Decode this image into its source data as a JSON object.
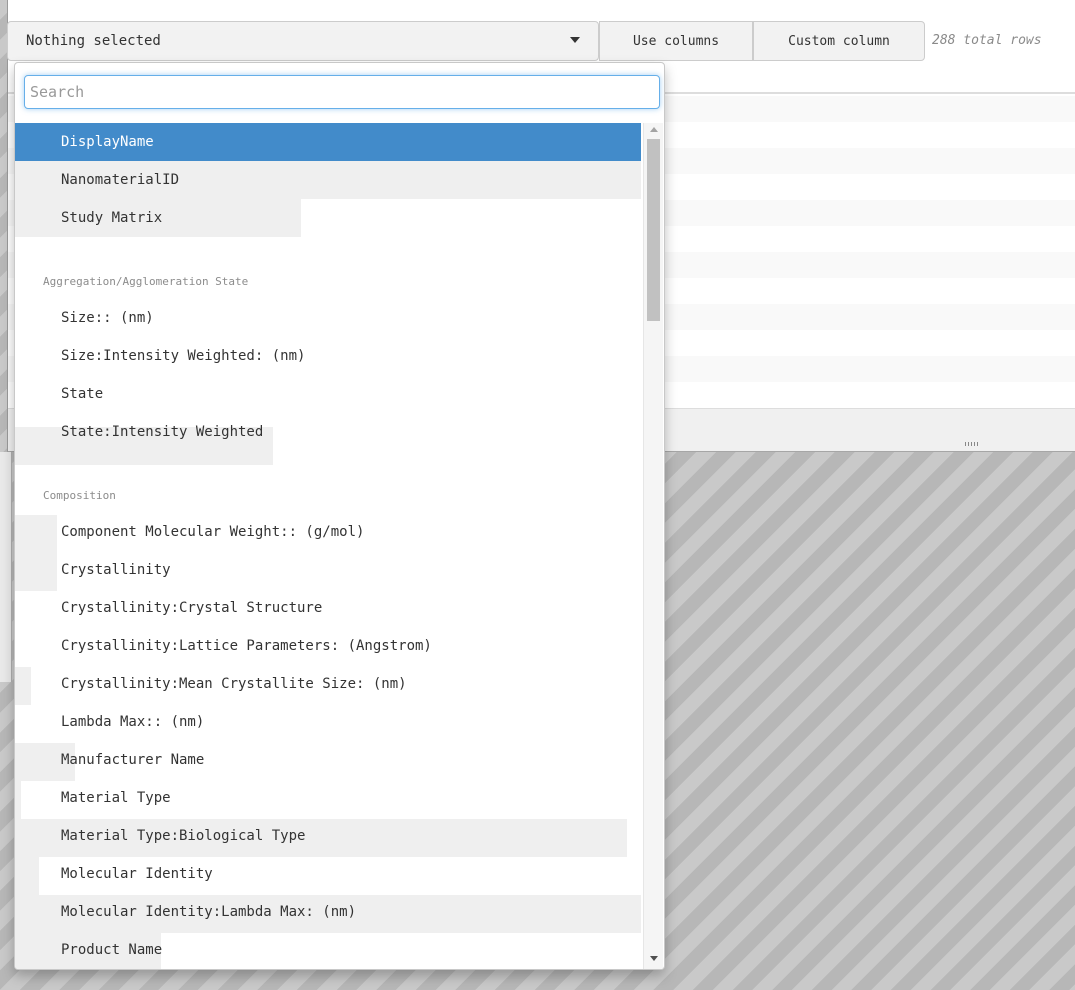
{
  "toolbar": {
    "select_label": "Nothing selected",
    "use_columns_label": "Use columns",
    "custom_column_label": "Custom column",
    "total_rows": "288 total rows"
  },
  "dropdown": {
    "search_placeholder": "Search",
    "items_top": [
      "DisplayName",
      "NanomaterialID",
      "Study Matrix"
    ],
    "groups": [
      {
        "header": "Aggregation/Agglomeration State",
        "items": [
          "Size:: (nm)",
          "Size:Intensity Weighted: (nm)",
          "State",
          "State:Intensity Weighted"
        ]
      },
      {
        "header": "Composition",
        "items": [
          "Component Molecular Weight:: (g/mol)",
          "Crystallinity",
          "Crystallinity:Crystal Structure",
          "Crystallinity:Lattice Parameters: (Angstrom)",
          "Crystallinity:Mean Crystallite Size: (nm)",
          "Lambda Max:: (nm)",
          "Manufacturer Name",
          "Material Type",
          "Material Type:Biological Type",
          "Molecular Identity",
          "Molecular Identity:Lambda Max: (nm)",
          "Product Name"
        ]
      }
    ],
    "selected_item": "DisplayName"
  },
  "colors": {
    "selected": "#428bca",
    "focus": "#66afe9"
  },
  "icons": [
    "caret-down-icon",
    "scroll-up-icon",
    "scroll-down-icon",
    "resize-grip-icon"
  ]
}
